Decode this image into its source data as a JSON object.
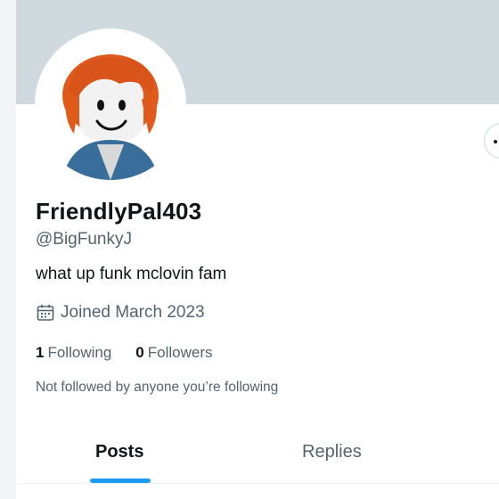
{
  "profile": {
    "display_name": "FriendlyPal403",
    "handle": "@BigFunkyJ",
    "bio": "what up funk mclovin fam",
    "joined": "Joined March 2023",
    "following_count": "1",
    "following_label": "Following",
    "followers_count": "0",
    "followers_label": "Followers",
    "followers_note": "Not followed by anyone you’re following"
  },
  "tabs": [
    {
      "label": "Posts",
      "active": true
    },
    {
      "label": "Replies",
      "active": false
    }
  ],
  "colors": {
    "banner": "#cfd9de",
    "accent": "#1d9bf0",
    "secondary_text": "#536471"
  },
  "icons": {
    "joined": "calendar-icon",
    "more": "more-options-icon"
  }
}
